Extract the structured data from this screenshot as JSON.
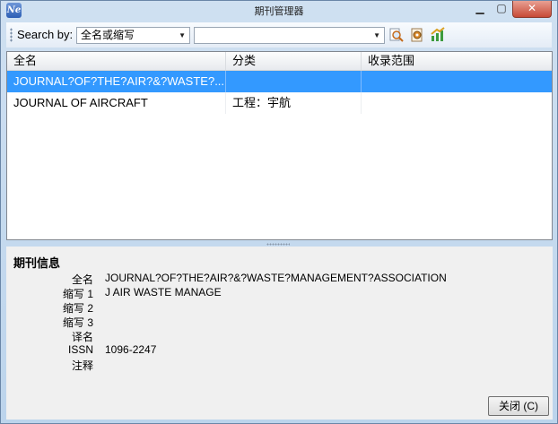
{
  "window": {
    "title": "期刊管理器",
    "icon_text": "Ne"
  },
  "toolbar": {
    "search_by_label": "Search by:",
    "search_field_selected": "全名或缩写",
    "search_value": "",
    "icons": [
      "search-icon",
      "settings-icon",
      "chart-up-icon"
    ]
  },
  "grid": {
    "columns": [
      "全名",
      "分类",
      "收录范围"
    ],
    "rows": [
      {
        "full_name": "JOURNAL?OF?THE?AIR?&?WASTE?...",
        "category": "",
        "coverage": "",
        "selected": true
      },
      {
        "full_name": "JOURNAL OF AIRCRAFT",
        "category": "工程：宇航",
        "coverage": "",
        "selected": false
      }
    ]
  },
  "info": {
    "heading": "期刊信息",
    "fields": [
      {
        "label": "全名",
        "value": "JOURNAL?OF?THE?AIR?&?WASTE?MANAGEMENT?ASSOCIATION"
      },
      {
        "label": "缩写 1",
        "value": "J AIR WASTE MANAGE"
      },
      {
        "label": "缩写 2",
        "value": ""
      },
      {
        "label": "缩写 3",
        "value": ""
      },
      {
        "label": "译名",
        "value": ""
      },
      {
        "label": "ISSN",
        "value": "1096-2247"
      },
      {
        "label": "注释",
        "value": ""
      }
    ]
  },
  "buttons": {
    "close_label": "关闭 (C)"
  },
  "colors": {
    "selection": "#3399ff",
    "frame": "#bcd4ec"
  }
}
